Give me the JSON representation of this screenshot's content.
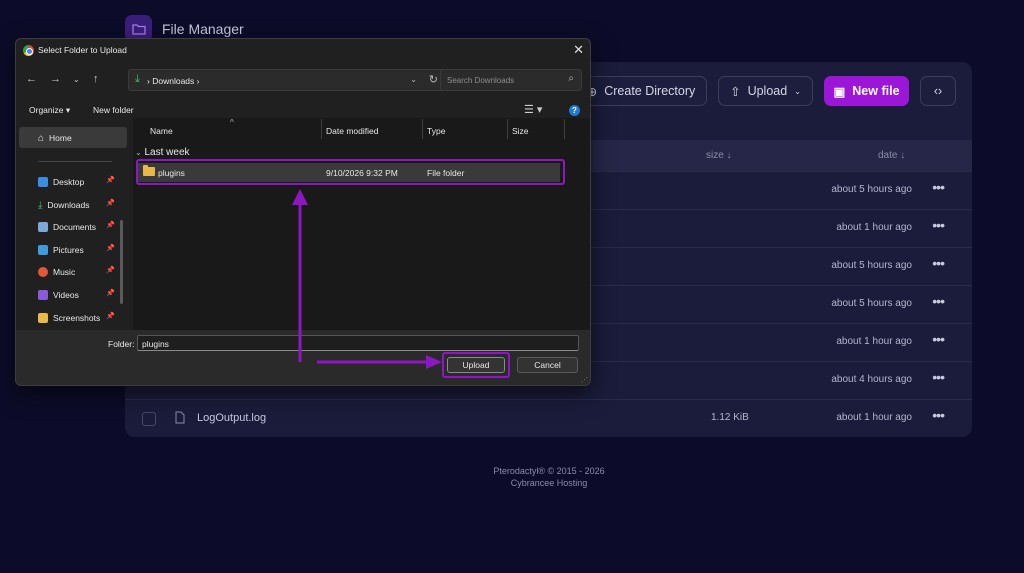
{
  "app": {
    "title": "File Manager",
    "buttons": {
      "create_directory": "Create Directory",
      "upload": "Upload",
      "new_file": "New file"
    },
    "table": {
      "headers": {
        "size": "size ↓",
        "date": "date ↓"
      },
      "rows": [
        {
          "name": "",
          "size": "",
          "date": "about 5 hours ago"
        },
        {
          "name": "",
          "size": "",
          "date": "about 1 hour ago"
        },
        {
          "name": "",
          "size": "",
          "date": "about 5 hours ago"
        },
        {
          "name": "",
          "size": "",
          "date": "about 5 hours ago"
        },
        {
          "name": "",
          "size": "",
          "date": "about 1 hour ago"
        },
        {
          "name": "",
          "size": "",
          "date": "about 4 hours ago"
        },
        {
          "name": "LogOutput.log",
          "size": "1.12 KiB",
          "date": "about 1 hour ago"
        }
      ],
      "more_label": "•••"
    },
    "footer": {
      "copyright": "Pterodactyl® © 2015 - 2026",
      "host": "Cybrancee Hosting"
    }
  },
  "dialog": {
    "title": "Select Folder to Upload",
    "close": "✕",
    "address": {
      "path": "Downloads",
      "sep": "›"
    },
    "search_placeholder": "Search Downloads",
    "commands": {
      "organize": "Organize ▾",
      "new_folder": "New folder"
    },
    "help": "?",
    "sidebar": [
      {
        "label": "Home"
      },
      {
        "label": "Desktop",
        "pinned": true
      },
      {
        "label": "Downloads",
        "pinned": true
      },
      {
        "label": "Documents",
        "pinned": true
      },
      {
        "label": "Pictures",
        "pinned": true
      },
      {
        "label": "Music",
        "pinned": true
      },
      {
        "label": "Videos",
        "pinned": true
      },
      {
        "label": "Screenshots",
        "pinned": true
      }
    ],
    "columns": {
      "name": "Name",
      "date_modified": "Date modified",
      "type": "Type",
      "size": "Size"
    },
    "group": "Last week",
    "files": [
      {
        "name": "plugins",
        "date_modified": "9/10/2026 9:32 PM",
        "type": "File folder",
        "size": ""
      }
    ],
    "folder_label": "Folder:",
    "folder_value": "plugins",
    "upload_button": "Upload",
    "cancel_button": "Cancel"
  },
  "colors": {
    "accent": "#9c16d8",
    "highlight": "#8b18c0",
    "background": "#0c0c2a",
    "panel": "#1b1c3b"
  }
}
